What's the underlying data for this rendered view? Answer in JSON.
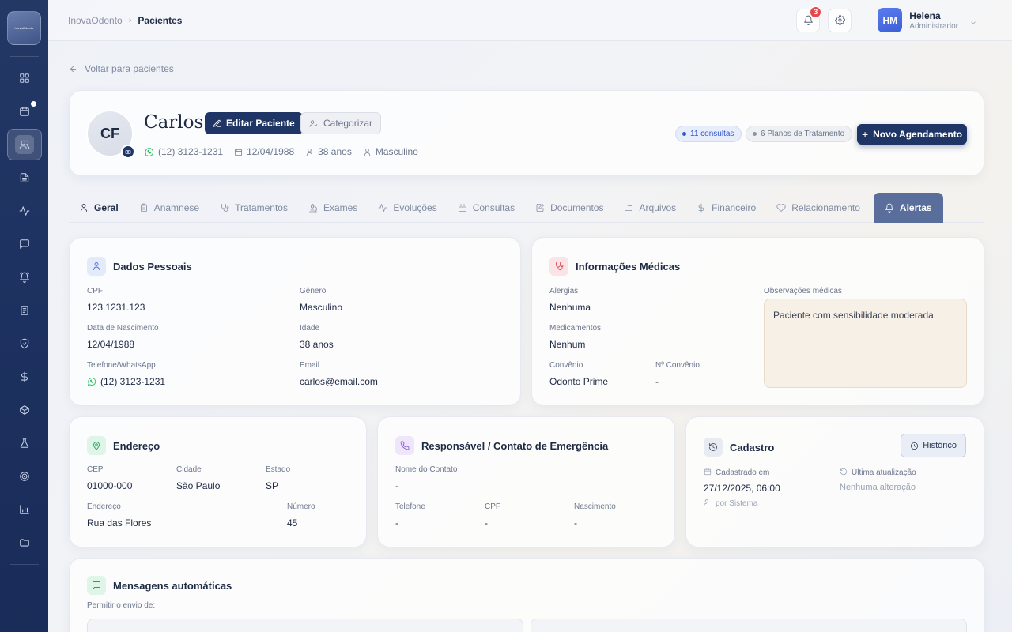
{
  "sidebar": {
    "logo_text": "InovaOdonto",
    "items": [
      {
        "icon": "grid-icon"
      },
      {
        "icon": "calendar-icon"
      },
      {
        "icon": "users-icon"
      },
      {
        "icon": "file-text-icon"
      },
      {
        "icon": "activity-icon"
      },
      {
        "icon": "message-icon"
      },
      {
        "icon": "alarm-icon"
      },
      {
        "icon": "receipt-icon"
      },
      {
        "icon": "shield-icon"
      },
      {
        "icon": "dollar-icon"
      },
      {
        "icon": "box-icon"
      },
      {
        "icon": "flask-icon"
      },
      {
        "icon": "target-icon"
      },
      {
        "icon": "bar-chart-icon"
      },
      {
        "icon": "folder-icon"
      }
    ]
  },
  "topbar": {
    "breadcrumb_root": "InovaOdonto",
    "breadcrumb_sep": "›",
    "breadcrumb_current": "Pacientes",
    "notif_count": "3",
    "user_initials": "HM",
    "user_name": "Helena",
    "user_role": "Administrador"
  },
  "back_label": "Voltar para pacientes",
  "patient": {
    "initials": "CF",
    "name": "Carlos",
    "edit_label": "Editar Paciente",
    "categorize_label": "Categorizar",
    "phone": "(12) 3123-1231",
    "birth": "12/04/1988",
    "age": "38 anos",
    "gender": "Masculino",
    "consultas_badge": "11 consultas",
    "planos_badge": "6 Planos de Tratamento",
    "new_appointment_label": "Novo Agendamento",
    "new_appointment_plus": "+"
  },
  "tabs": [
    {
      "label": "Geral",
      "icon": "user-icon"
    },
    {
      "label": "Anamnese",
      "icon": "clipboard-icon"
    },
    {
      "label": "Tratamentos",
      "icon": "stethoscope-icon"
    },
    {
      "label": "Exames",
      "icon": "microscope-icon"
    },
    {
      "label": "Evoluções",
      "icon": "activity-icon"
    },
    {
      "label": "Consultas",
      "icon": "calendar-icon"
    },
    {
      "label": "Documentos",
      "icon": "file-edit-icon"
    },
    {
      "label": "Arquivos",
      "icon": "folder-icon"
    },
    {
      "label": "Financeiro",
      "icon": "dollar-icon"
    },
    {
      "label": "Relacionamento",
      "icon": "heart-icon"
    },
    {
      "label": "Alertas",
      "icon": "bell-icon"
    }
  ],
  "dados_pessoais": {
    "title": "Dados Pessoais",
    "cpf_label": "CPF",
    "cpf": "123.1231.123",
    "genero_label": "Gênero",
    "genero": "Masculino",
    "nasc_label": "Data de Nascimento",
    "nasc": "12/04/1988",
    "idade_label": "Idade",
    "idade": "38 anos",
    "tel_label": "Telefone/WhatsApp",
    "tel": "(12) 3123-1231",
    "email_label": "Email",
    "email": "carlos@email.com"
  },
  "info_medicas": {
    "title": "Informações Médicas",
    "alergias_label": "Alergias",
    "alergias": "Nenhuma",
    "med_label": "Medicamentos",
    "med": "Nenhum",
    "convenio_label": "Convênio",
    "convenio": "Odonto Prime",
    "nconv_label": "Nº Convênio",
    "nconv": "-",
    "obs_label": "Observações médicas",
    "obs": "Paciente com sensibilidade moderada."
  },
  "endereco": {
    "title": "Endereço",
    "cep_label": "CEP",
    "cep": "01000-000",
    "cidade_label": "Cidade",
    "cidade": "São Paulo",
    "estado_label": "Estado",
    "estado": "SP",
    "end_label": "Endereço",
    "end": "Rua das Flores",
    "num_label": "Número",
    "num": "45"
  },
  "responsavel": {
    "title": "Responsável / Contato de Emergência",
    "nome_label": "Nome do Contato",
    "nome": "-",
    "tel_label": "Telefone",
    "tel": "-",
    "cpf_label": "CPF",
    "cpf": "-",
    "nasc_label": "Nascimento",
    "nasc": "-"
  },
  "cadastro": {
    "title": "Cadastro",
    "hist_label": "Histórico",
    "cad_label": "Cadastrado em",
    "cad": "27/12/2025, 06:00",
    "por": "por Sistema",
    "upd_label": "Última atualização",
    "upd": "Nenhuma alteração"
  },
  "mensagens": {
    "title": "Mensagens automáticas",
    "subtitle": "Permitir o envio de:"
  }
}
